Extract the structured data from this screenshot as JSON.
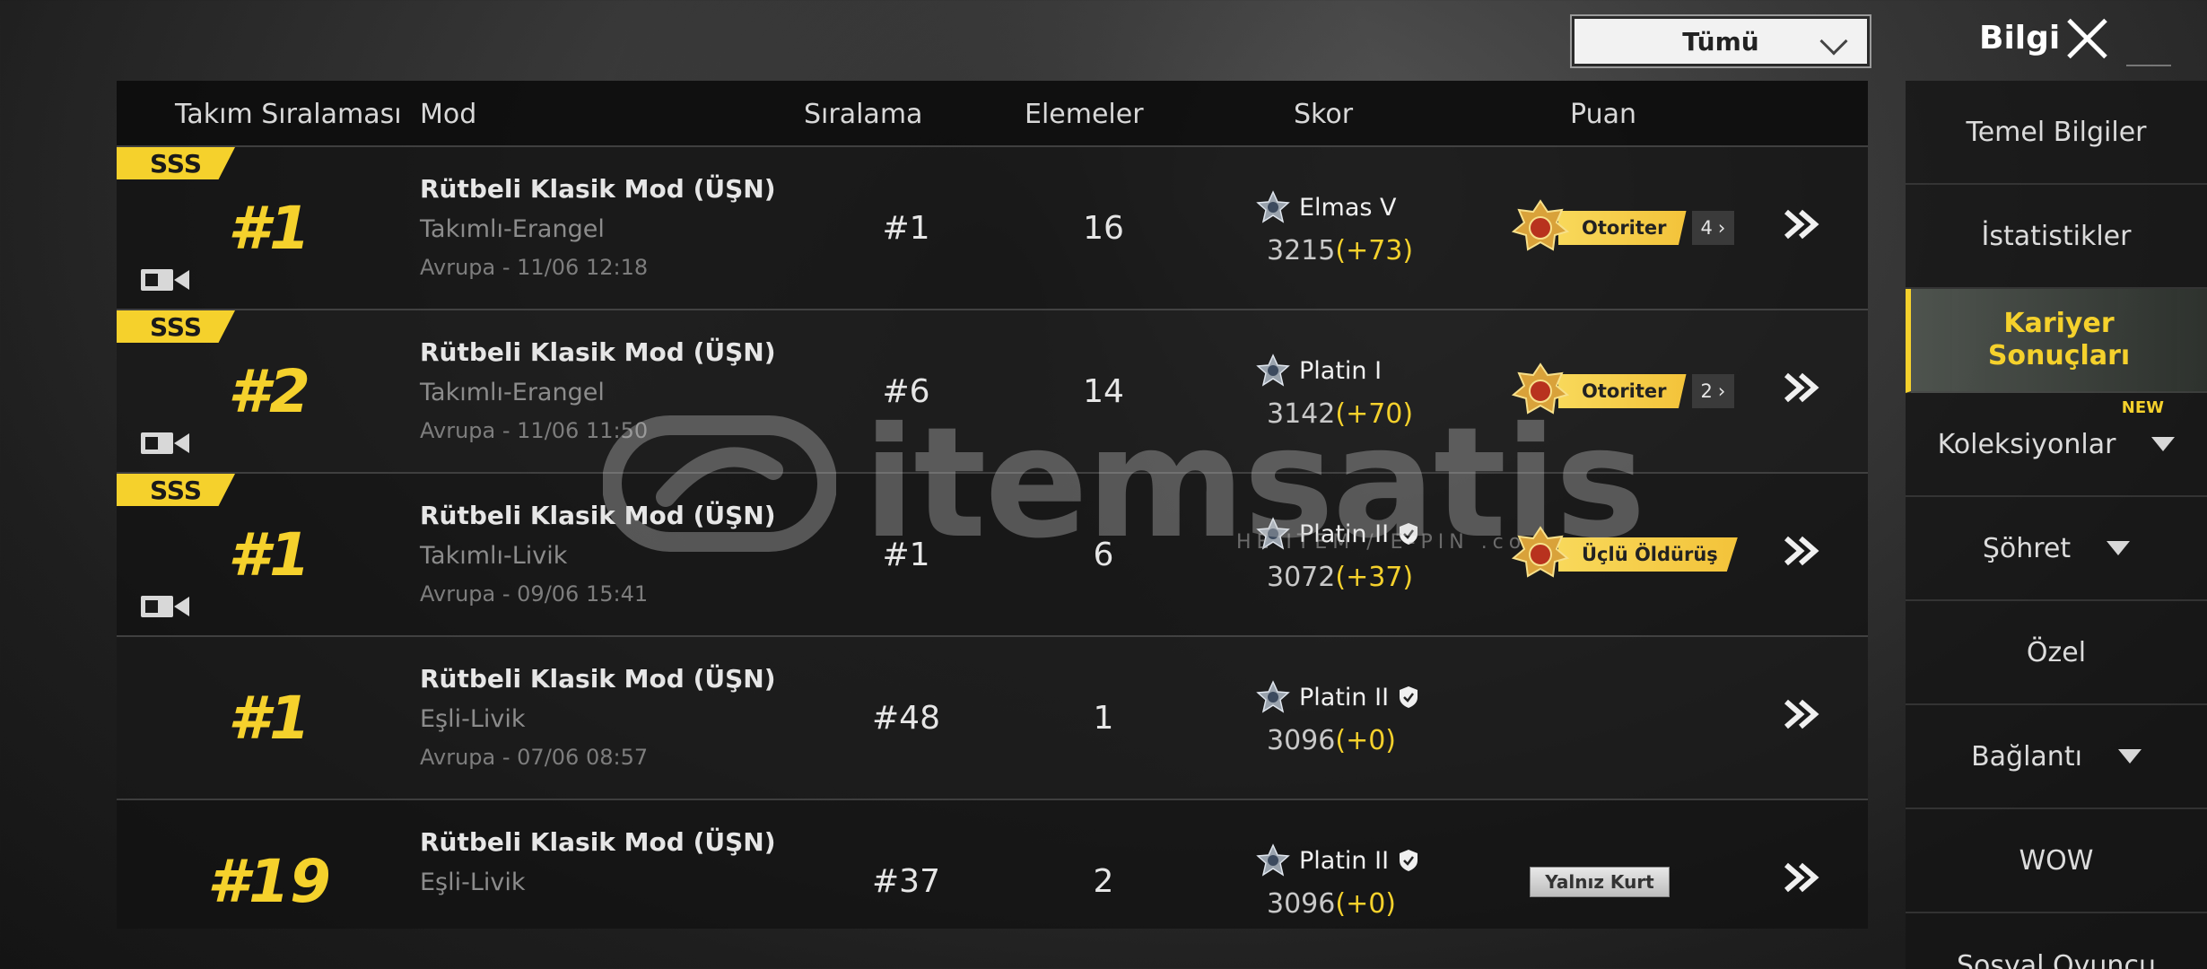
{
  "topbar": {
    "filter_value": "Tümü",
    "title": "Bilgi"
  },
  "table": {
    "headers": {
      "team_rank": "Takım Sıralaması",
      "mode": "Mod",
      "placement": "Sıralama",
      "kills": "Elemeler",
      "score": "Skor",
      "points": "Puan"
    },
    "rows": [
      {
        "sss": "SSS",
        "team_rank": "#1",
        "mode": "Rütbeli Klasik Mod (ÜŞN)",
        "map": "Takımlı-Erangel",
        "meta": "Avrupa - 11/06 12:18",
        "placement": "#1",
        "kills": "16",
        "tier": "Elmas V",
        "score": "3215",
        "delta": "(+73)",
        "honor_label": "Otoriter",
        "honor_count": "4"
      },
      {
        "sss": "SSS",
        "team_rank": "#2",
        "mode": "Rütbeli Klasik Mod (ÜŞN)",
        "map": "Takımlı-Erangel",
        "meta": "Avrupa - 11/06 11:50",
        "placement": "#6",
        "kills": "14",
        "tier": "Platin I",
        "score": "3142",
        "delta": "(+70)",
        "honor_label": "Otoriter",
        "honor_count": "2"
      },
      {
        "sss": "SSS",
        "team_rank": "#1",
        "mode": "Rütbeli Klasik Mod (ÜŞN)",
        "map": "Takımlı-Livik",
        "meta": "Avrupa - 09/06 15:41",
        "placement": "#1",
        "kills": "6",
        "tier": "Platin II",
        "score": "3072",
        "delta": "(+37)",
        "honor_label": "Üçlü Öldürüş"
      },
      {
        "team_rank": "#1",
        "mode": "Rütbeli Klasik Mod (ÜŞN)",
        "map": "Eşli-Livik",
        "meta": "Avrupa - 07/06 08:57",
        "placement": "#48",
        "kills": "1",
        "tier": "Platin II",
        "score": "3096",
        "delta": "(+0)"
      },
      {
        "team_rank": "#19",
        "mode": "Rütbeli Klasik Mod (ÜŞN)",
        "map": "Eşli-Livik",
        "meta": "",
        "placement": "#37",
        "kills": "2",
        "tier": "Platin II",
        "score": "3096",
        "delta": "(+0)",
        "honor_label": "Yalnız Kurt"
      }
    ]
  },
  "sidebar": {
    "items": [
      {
        "label": "Temel Bilgiler"
      },
      {
        "label": "İstatistikler"
      },
      {
        "label": "Kariyer Sonuçları",
        "line1": "Kariyer",
        "line2": "Sonuçları"
      },
      {
        "label": "Koleksiyonlar",
        "badge": "NEW"
      },
      {
        "label": "Şöhret"
      },
      {
        "label": "Özel"
      },
      {
        "label": "Bağlantı"
      },
      {
        "label": "WOW"
      },
      {
        "label": "Sosyal Oyuncu"
      }
    ]
  },
  "watermark": {
    "text": "itemsatis",
    "sub": "HE   ITEM / E-PIN   .com"
  },
  "colors": {
    "accent": "#f5d12c",
    "panel": "#121212",
    "text": "#e6e6e6"
  },
  "icons": {
    "close": "close-icon",
    "video": "video-camera-icon",
    "arrow": "double-chevron-right-icon",
    "dropdown": "chevron-down-icon",
    "tier": "rank-tier-icon",
    "medal": "honor-medal-icon"
  }
}
